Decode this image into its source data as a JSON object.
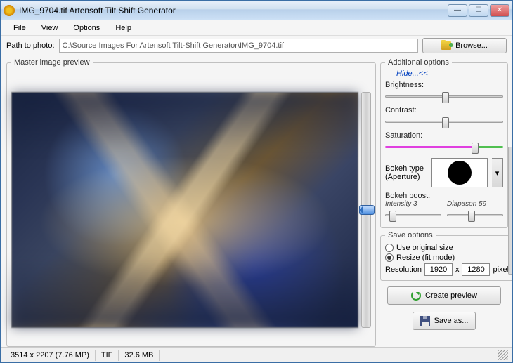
{
  "window": {
    "title": "IMG_9704.tif Artensoft Tilt Shift Generator"
  },
  "menu": {
    "file": "File",
    "view": "View",
    "options": "Options",
    "help": "Help"
  },
  "pathbar": {
    "label": "Path to photo:",
    "value": "C:\\Source Images For Artensoft Tilt-Shift Generator\\IMG_9704.tif",
    "browse": "Browse..."
  },
  "preview": {
    "legend": "Master image preview"
  },
  "additional": {
    "legend": "Additional options",
    "hide": "Hide...<<",
    "brightness_label": "Brightness:",
    "contrast_label": "Contrast:",
    "saturation_label": "Saturation:",
    "bokeh_type_label": "Bokeh type (Aperture)",
    "bokeh_boost_label": "Bokeh boost:",
    "intensity_label": "Intensity 3",
    "diapason_label": "Diapason 59"
  },
  "save": {
    "legend": "Save options",
    "use_original": "Use original size",
    "resize": "Resize (fit mode)",
    "resolution_label": "Resolution",
    "width": "1920",
    "x": "x",
    "height": "1280",
    "pixels": "pixels"
  },
  "actions": {
    "create_preview": "Create preview",
    "save_as": "Save as..."
  },
  "status": {
    "dimensions": "3514 x 2207 (7.76 MP)",
    "format": "TIF",
    "size": "32.6 MB"
  }
}
